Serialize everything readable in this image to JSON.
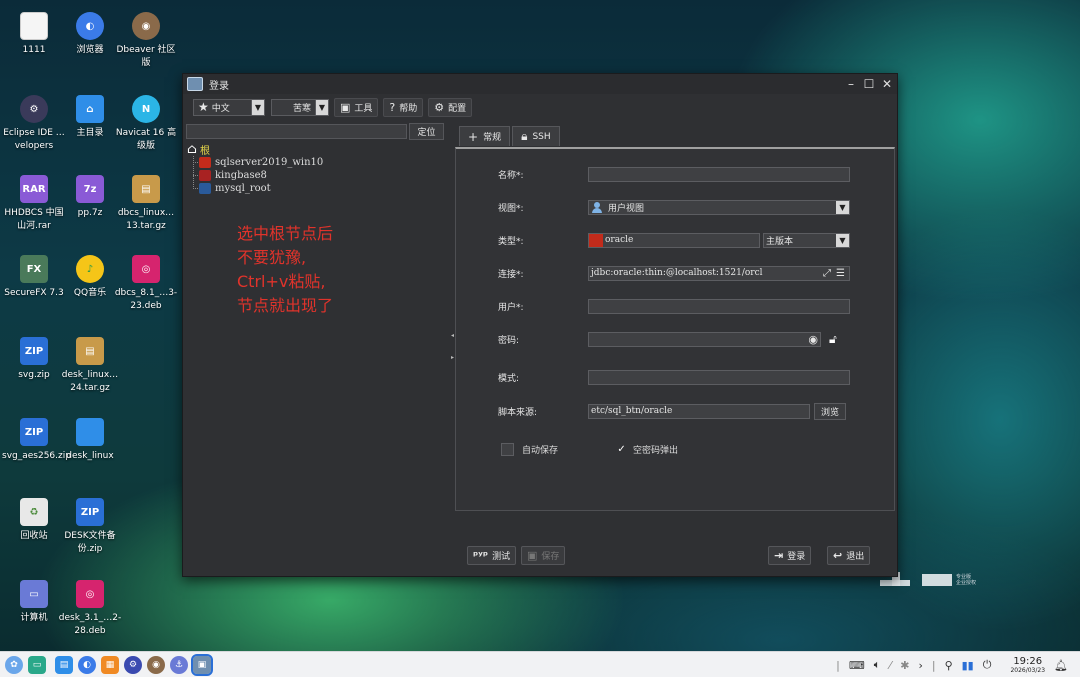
{
  "desktop": {
    "icons": [
      {
        "label": "1111",
        "icon": "document-icon",
        "color": "#f5f5f5"
      },
      {
        "label": "浏览器",
        "icon": "browser-icon",
        "color": "#3b7be8"
      },
      {
        "label": "Dbeaver 社区版",
        "icon": "dbeaver-icon",
        "color": "#8a6a4a"
      },
      {
        "label": "Eclipse IDE …velopers",
        "icon": "eclipse-icon",
        "color": "#3a3a5a"
      },
      {
        "label": "主目录",
        "icon": "home-folder-icon",
        "color": "#2f8ee8"
      },
      {
        "label": "Navicat 16 高级版",
        "icon": "navicat-icon",
        "color": "#2bb5e6"
      },
      {
        "label": "HHDBCS 中国山河.rar",
        "icon": "rar-archive-icon",
        "color": "#8a5ad6"
      },
      {
        "label": "pp.7z",
        "icon": "7z-archive-icon",
        "color": "#8a5ad6"
      },
      {
        "label": "dbcs_linux…13.tar.gz",
        "icon": "tar-archive-icon",
        "color": "#c89a4a"
      },
      {
        "label": "SecureFX 7.3",
        "icon": "securefx-icon",
        "color": "#4a7a5a"
      },
      {
        "label": "QQ音乐",
        "icon": "qq-music-icon",
        "color": "#f5c518"
      },
      {
        "label": "dbcs_8.1_…3-23.deb",
        "icon": "deb-package-icon",
        "color": "#d6246e"
      },
      {
        "label": "svg.zip",
        "icon": "zip-archive-icon",
        "color": "#2a6fd6"
      },
      {
        "label": "desk_linux…24.tar.gz",
        "icon": "tar-archive-icon",
        "color": "#c89a4a"
      },
      {
        "label": "svg_aes256.zip",
        "icon": "zip-archive-icon",
        "color": "#2a6fd6"
      },
      {
        "label": "desk_linux",
        "icon": "folder-icon",
        "color": "#2f8ee8"
      },
      {
        "label": "回收站",
        "icon": "trash-icon",
        "color": "#e8e8e8"
      },
      {
        "label": "DESK文件备份.zip",
        "icon": "zip-archive-icon",
        "color": "#2a6fd6"
      },
      {
        "label": "计算机",
        "icon": "computer-icon",
        "color": "#6a7ad6"
      },
      {
        "label": "desk_3.1_…2-28.deb",
        "icon": "deb-package-icon",
        "color": "#d6246e"
      }
    ]
  },
  "dialog": {
    "title": "登录",
    "toolbar": {
      "language_value": "中文",
      "theme_value": "苦寒",
      "tools_label": "工具",
      "help_label": "帮助",
      "config_label": "配置"
    },
    "left": {
      "search_value": "",
      "locate_label": "定位",
      "tree_root": "根",
      "tree_items": [
        {
          "label": "sqlserver2019_win10",
          "color": "#c22b1b"
        },
        {
          "label": "kingbase8",
          "color": "#a82222"
        },
        {
          "label": "mysql_root",
          "color": "#2a5a9a"
        }
      ],
      "annotation": [
        "选中根节点后",
        "不要犹豫,",
        "Ctrl+v粘贴,",
        "节点就出现了"
      ]
    },
    "tabs": [
      {
        "label": "常规",
        "icon": "plus-icon"
      },
      {
        "label": "SSH",
        "icon": "lock-icon"
      }
    ],
    "form": {
      "name_label": "名称*:",
      "name_value": "",
      "view_label": "视图*:",
      "view_value": "用户视图",
      "type_label": "类型*:",
      "type_value": "oracle",
      "edition_value": "主版本",
      "conn_label": "连接*:",
      "conn_value": "jdbc:oracle:thin:@localhost:1521/orcl",
      "user_label": "用户*:",
      "user_value": "",
      "password_label": "密码:",
      "password_value": "",
      "schema_label": "模式:",
      "schema_value": "",
      "script_label": "脚本来源:",
      "script_value": "etc/sql_btn/oracle",
      "browse_label": "浏览",
      "autosave_label": "自动保存",
      "autosave_checked": false,
      "empty_pwd_label": "空密码弹出",
      "empty_pwd_checked": true
    },
    "bottom": {
      "test_label": "测试",
      "save_label": "保存",
      "login_label": "登录",
      "exit_label": "退出"
    }
  },
  "taskbar": {
    "time": "19:26",
    "date": "2026/03/23"
  },
  "colors": {
    "dialog_bg": "#2f3033",
    "annotation": "#e0332b",
    "tree_root": "#e8d84a",
    "taskbar_bg": "#f1f2f4"
  }
}
